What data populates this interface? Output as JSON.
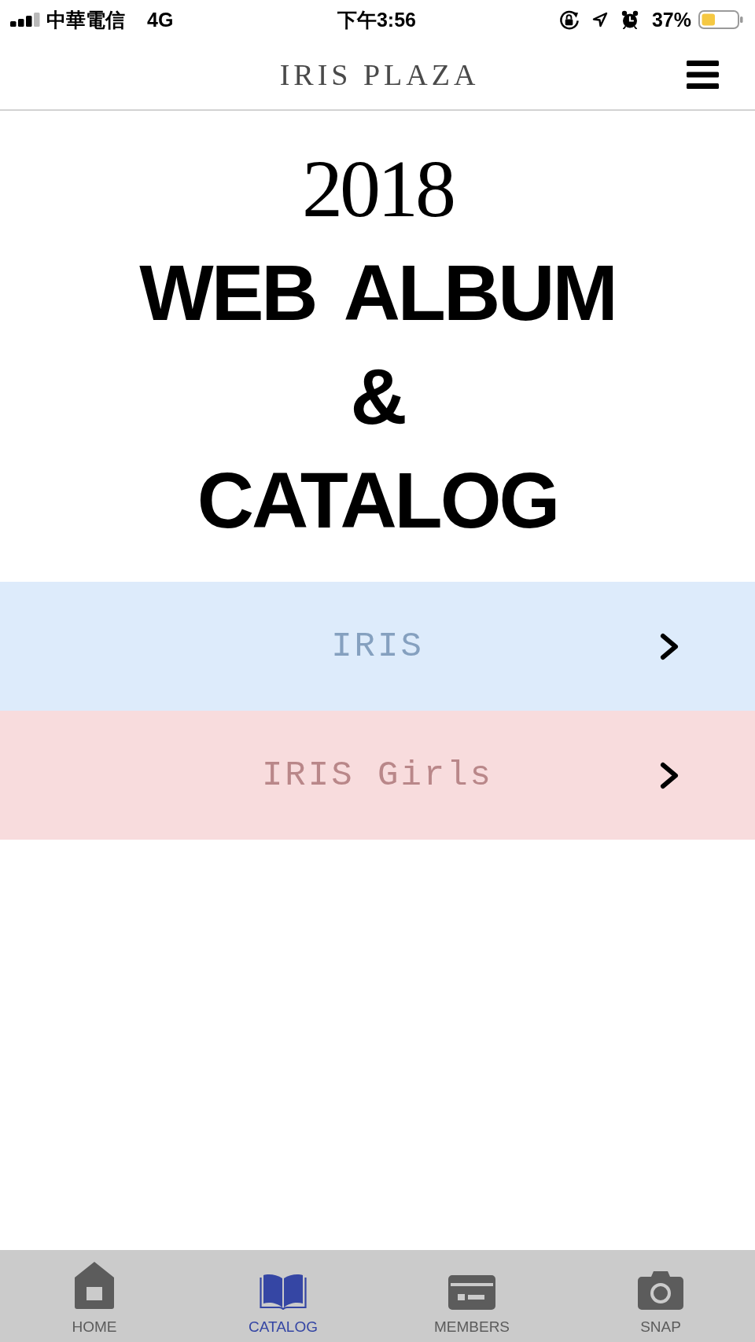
{
  "status_bar": {
    "carrier": "中華電信",
    "network": "4G",
    "time": "下午3:56",
    "battery": "37%"
  },
  "header": {
    "title": "IRIS PLAZA"
  },
  "banner": {
    "lines": [
      {
        "text": "2018",
        "kind": "year"
      },
      {
        "text": "WEB ALBUM",
        "kind": "heading"
      },
      {
        "text": "&",
        "kind": "heading"
      },
      {
        "text": "CATALOG",
        "kind": "heading"
      }
    ]
  },
  "categories": [
    {
      "label": "IRIS",
      "color": "#ddebfb"
    },
    {
      "label": "IRIS Girls",
      "color": "#f8dcdd"
    }
  ],
  "tab_bar": [
    {
      "label": "HOME",
      "selected": false
    },
    {
      "label": "CATALOG",
      "selected": true
    },
    {
      "label": "MEMBERS",
      "selected": false
    },
    {
      "label": "SNAP",
      "selected": false
    }
  ]
}
